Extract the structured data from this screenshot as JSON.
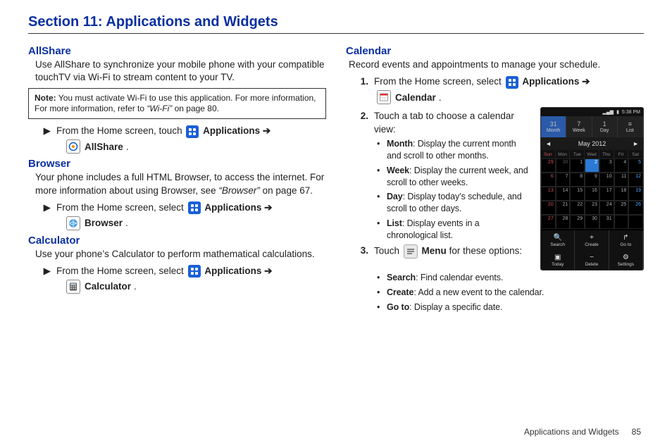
{
  "section_title": "Section 11: Applications and Widgets",
  "footer": {
    "label": "Applications and Widgets",
    "page": "85"
  },
  "allshare": {
    "heading": "AllShare",
    "body": "Use AllShare to synchronize your mobile phone with your compatible touchTV via Wi-Fi to stream content to your TV.",
    "note_label": "Note:",
    "note_body_a": "You must activate Wi-Fi to use this application. For more information, For more information, refer to ",
    "note_ref": "“Wi-Fi”",
    "note_body_b": "  on page 80.",
    "step_lead": "From the Home screen, touch ",
    "apps_label": "Applications",
    "app_label": "AllShare"
  },
  "browser": {
    "heading": "Browser",
    "body_a": "Your phone includes a full HTML Browser, to access the internet. For more information about using Browser, see ",
    "body_ref": "“Browser”",
    "body_b": " on page 67.",
    "step_lead": "From the Home screen, select ",
    "apps_label": "Applications",
    "app_label": "Browser"
  },
  "calculator": {
    "heading": "Calculator",
    "body": "Use your phone’s Calculator to perform mathematical calculations.",
    "step_lead": "From the Home screen, select ",
    "apps_label": "Applications",
    "app_label": "Calculator"
  },
  "calendar": {
    "heading": "Calendar",
    "body": "Record events and appointments to manage your schedule.",
    "step1_lead": "From the Home screen, select ",
    "apps_label": "Applications",
    "app_label": "Calendar",
    "step2": "Touch a tab to choose a calendar view:",
    "views": [
      {
        "name": "Month",
        "desc": ": Display the current month and scroll to other months."
      },
      {
        "name": "Week",
        "desc": ": Display the current week, and scroll to other weeks."
      },
      {
        "name": "Day",
        "desc": ": Display today’s schedule, and scroll to other days."
      },
      {
        "name": "List",
        "desc": ": Display events in a chronological list."
      }
    ],
    "step3_a": "Touch ",
    "step3_menu": "Menu",
    "step3_b": " for these options:",
    "options": [
      {
        "name": "Search",
        "desc": ": Find calendar events."
      },
      {
        "name": "Create",
        "desc": ": Add a new event to the calendar."
      },
      {
        "name": "Go to",
        "desc": ": Display a specific date."
      }
    ]
  },
  "phone": {
    "time": "5:38 PM",
    "tabs": [
      {
        "num": "31",
        "label": "Month"
      },
      {
        "num": "7",
        "label": "Week"
      },
      {
        "num": "1",
        "label": "Day"
      },
      {
        "num": "",
        "label": "List"
      }
    ],
    "month_label": "May  2012",
    "dow": [
      "Sun",
      "Mon",
      "Tue",
      "Wed",
      "Thu",
      "Fri",
      "Sat"
    ],
    "weeks": [
      [
        "29",
        "30",
        "1",
        "2",
        "3",
        "4",
        "5"
      ],
      [
        "6",
        "7",
        "8",
        "9",
        "10",
        "11",
        "12"
      ],
      [
        "13",
        "14",
        "15",
        "16",
        "17",
        "18",
        "19"
      ],
      [
        "20",
        "21",
        "22",
        "23",
        "24",
        "25",
        "26"
      ],
      [
        "27",
        "28",
        "29",
        "30",
        "31",
        "",
        ""
      ]
    ],
    "today": "2",
    "actions_row1": [
      {
        "icon": "🔍",
        "label": "Search"
      },
      {
        "icon": "+",
        "label": "Create"
      },
      {
        "icon": "↱",
        "label": "Go to"
      }
    ],
    "actions_row2": [
      {
        "icon": "▣",
        "label": "Today"
      },
      {
        "icon": "−",
        "label": "Delete"
      },
      {
        "icon": "⚙",
        "label": "Settings"
      }
    ]
  },
  "glyphs": {
    "tri": "▶",
    "arrow": "➔"
  }
}
